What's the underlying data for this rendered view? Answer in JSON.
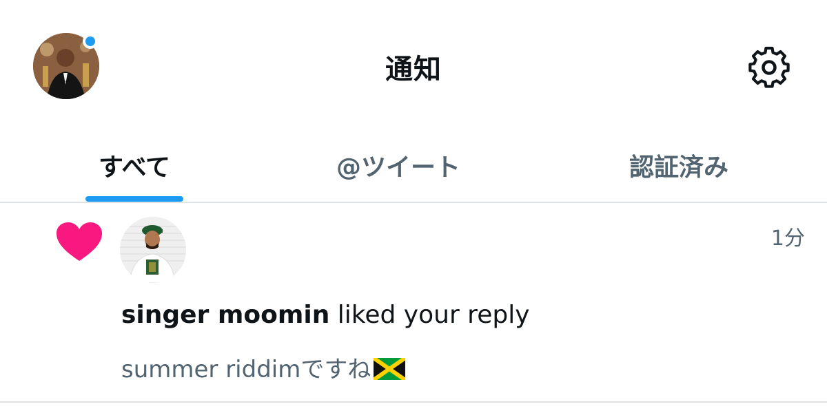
{
  "header": {
    "title": "通知",
    "avatar_icon": "profile-avatar",
    "status_dot_color": "#1d9bf0",
    "settings_icon": "gear-icon"
  },
  "tabs": [
    {
      "label": "すべて",
      "active": true
    },
    {
      "label": "@ツイート",
      "active": false
    },
    {
      "label": "認証済み",
      "active": false
    }
  ],
  "accent_color": "#1d9bf0",
  "notification": {
    "type_icon": "heart-icon",
    "type_color": "#f91880",
    "timestamp": "1分",
    "user_name": "singer moomin",
    "action_text": "liked your reply",
    "reply_text": "summer riddimですね",
    "emoji": "jamaica-flag"
  }
}
